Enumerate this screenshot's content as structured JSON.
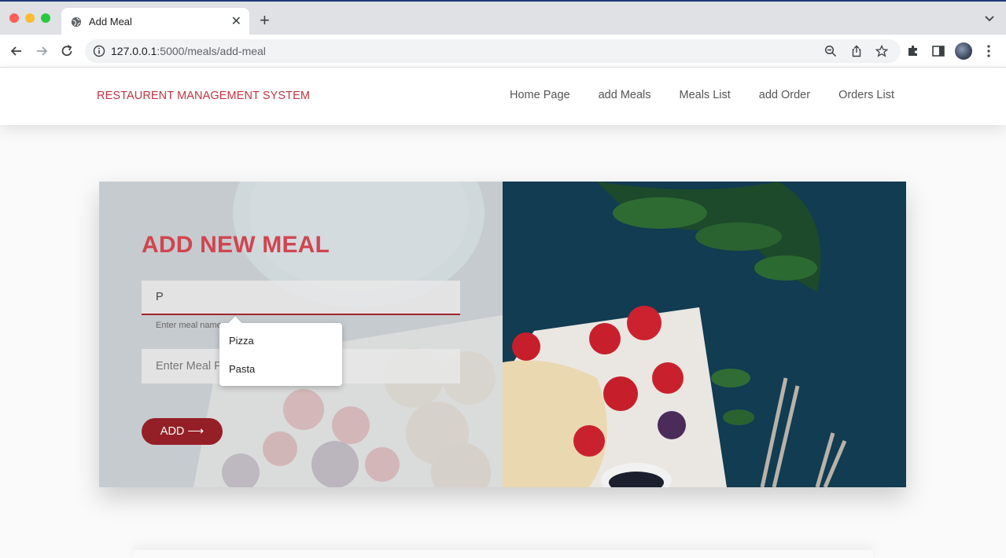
{
  "browser": {
    "tab_title": "Add Meal",
    "new_tab_label": "+",
    "url_host": "127.0.0.1",
    "url_path": ":5000/meals/add-meal"
  },
  "site": {
    "brand": "RESTAURENT MANAGEMENT SYSTEM",
    "nav": [
      "Home Page",
      "add Meals",
      "Meals List",
      "add Order",
      "Orders List"
    ]
  },
  "form": {
    "title": "ADD NEW MEAL",
    "name_value": "P",
    "name_hint": "Enter meal name",
    "price_placeholder": "Enter Meal Price",
    "add_label": "ADD",
    "add_arrow": "⟶"
  },
  "autocomplete": {
    "options": [
      "Pizza",
      "Pasta"
    ]
  },
  "colors": {
    "brand": "#c0343f",
    "accent": "#951f26",
    "title": "#d14550"
  }
}
